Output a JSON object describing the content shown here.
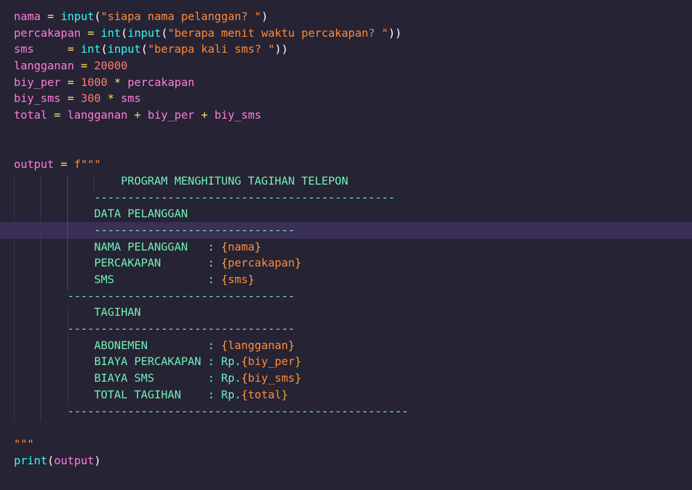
{
  "editor": {
    "language": "python",
    "colors": {
      "background": "#262335",
      "highlight_line": "#3a2f55",
      "identifier": "#ff7edb",
      "operator": "#fede5d",
      "function": "#36f9f6",
      "string": "#ff8b39",
      "number": "#f97e72",
      "fstring_text": "#72f1b8",
      "interpolation_brace": "#f2a63c"
    },
    "code": {
      "l1": [
        "nama",
        " = ",
        "input",
        "(",
        "\"siapa nama pelanggan? \"",
        ")"
      ],
      "l2": [
        "percakapan",
        " = ",
        "int",
        "(",
        "input",
        "(",
        "\"berapa menit waktu percakapan? \"",
        "))"
      ],
      "l3": [
        "sms",
        "     = ",
        "int",
        "(",
        "input",
        "(",
        "\"berapa kali sms? \"",
        "))"
      ],
      "l4": [
        "langganan",
        " = ",
        "20000"
      ],
      "l5": [
        "biy_per",
        " = ",
        "1000",
        " * ",
        "percakapan"
      ],
      "l6": [
        "biy_sms",
        " = ",
        "300",
        " * ",
        "sms"
      ],
      "l7": [
        "total",
        " = ",
        "langganan",
        " + ",
        "biy_per",
        " + ",
        "biy_sms"
      ],
      "l10": [
        "output",
        " = ",
        "f\"\"\""
      ],
      "l11": "                PROGRAM MENGHITUNG TAGIHAN TELEPON",
      "l12": "            ---------------------------------------------",
      "l13": "            DATA PELANGGAN",
      "l14": "            ------------------------------",
      "l15": [
        "            NAMA PELANGGAN   : ",
        "{",
        "nama",
        "}"
      ],
      "l16": [
        "            PERCAKAPAN       : ",
        "{",
        "percakapan",
        "}"
      ],
      "l17": [
        "            SMS              : ",
        "{",
        "sms",
        "}"
      ],
      "l18": "        ----------------------------------",
      "l19": "            TAGIHAN",
      "l20": "        ----------------------------------",
      "l21": [
        "            ABONEMEN         : ",
        "{",
        "langganan",
        "}"
      ],
      "l22": [
        "            BIAYA PERCAKAPAN : Rp.",
        "{",
        "biy_per",
        "}"
      ],
      "l23": [
        "            BIAYA SMS        : Rp.",
        "{",
        "biy_sms",
        "}"
      ],
      "l24": [
        "            TOTAL TAGIHAN    : Rp.",
        "{",
        "total",
        "}"
      ],
      "l25": "        ---------------------------------------------------",
      "l27": "\"\"\"",
      "l28": [
        "print",
        "(",
        "output",
        ")"
      ]
    }
  }
}
